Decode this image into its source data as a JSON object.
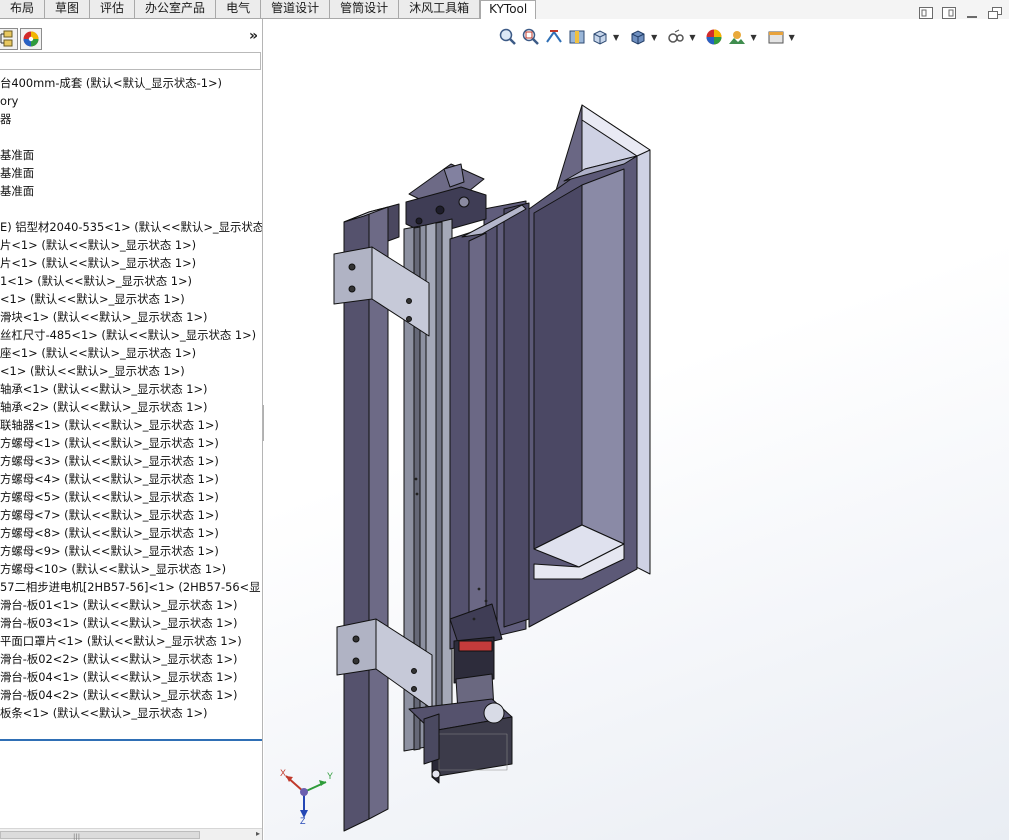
{
  "tabs": [
    {
      "label": "布局"
    },
    {
      "label": "草图"
    },
    {
      "label": "评估"
    },
    {
      "label": "办公室产品"
    },
    {
      "label": "电气"
    },
    {
      "label": "管道设计"
    },
    {
      "label": "管筒设计"
    },
    {
      "label": "沐风工具箱"
    },
    {
      "label": "KYTool"
    }
  ],
  "active_tab": "KYTool",
  "panel": {
    "expand_label": "»",
    "tree": [
      "台400mm-成套  (默认<默认_显示状态-1>)",
      "ory",
      "器",
      "",
      "基准面",
      "基准面",
      "基准面",
      "",
      "E) 铝型材2040-535<1> (默认<<默认>_显示状态",
      "片<1> (默认<<默认>_显示状态 1>)",
      "片<1> (默认<<默认>_显示状态 1>)",
      "1<1> (默认<<默认>_显示状态 1>)",
      "<1> (默认<<默认>_显示状态 1>)",
      "滑块<1> (默认<<默认>_显示状态 1>)",
      "丝杠尺寸-485<1> (默认<<默认>_显示状态 1>)",
      "座<1> (默认<<默认>_显示状态 1>)",
      "<1> (默认<<默认>_显示状态 1>)",
      "轴承<1> (默认<<默认>_显示状态 1>)",
      "轴承<2> (默认<<默认>_显示状态 1>)",
      "联轴器<1> (默认<<默认>_显示状态 1>)",
      "方螺母<1> (默认<<默认>_显示状态 1>)",
      "方螺母<3> (默认<<默认>_显示状态 1>)",
      "方螺母<4> (默认<<默认>_显示状态 1>)",
      "方螺母<5> (默认<<默认>_显示状态 1>)",
      "方螺母<7> (默认<<默认>_显示状态 1>)",
      "方螺母<8> (默认<<默认>_显示状态 1>)",
      "方螺母<9> (默认<<默认>_显示状态 1>)",
      "方螺母<10> (默认<<默认>_显示状态 1>)",
      "57二相步进电机[2HB57-56]<1> (2HB57-56<显",
      "滑台-板01<1> (默认<<默认>_显示状态 1>)",
      "滑台-板03<1> (默认<<默认>_显示状态 1>)",
      "平面口罩片<1> (默认<<默认>_显示状态 1>)",
      "滑台-板02<2> (默认<<默认>_显示状态 1>)",
      "滑台-板04<1> (默认<<默认>_显示状态 1>)",
      "滑台-板04<2> (默认<<默认>_显示状态 1>)",
      "板条<1> (默认<<默认>_显示状态 1>)"
    ]
  },
  "triad": {
    "x": "X",
    "y": "Y",
    "z": "Z"
  },
  "icons": {
    "heads_up": [
      "zoom-to-fit-icon",
      "zoom-area-icon",
      "previous-view-icon",
      "section-view-icon",
      "view-orientation-icon",
      "display-style-icon",
      "hide-show-icon",
      "edit-appearance-icon",
      "apply-scene-icon",
      "view-settings-icon"
    ],
    "window": [
      "tile-left-icon",
      "tile-right-icon",
      "minimize-icon",
      "restore-icon"
    ]
  },
  "colors": {
    "part_face": "#5d5a77",
    "part_dark": "#3f3d55",
    "part_light": "#d9dae9",
    "aluminium": "#9aa0ae",
    "accent_blue": "#2f6fb5"
  }
}
